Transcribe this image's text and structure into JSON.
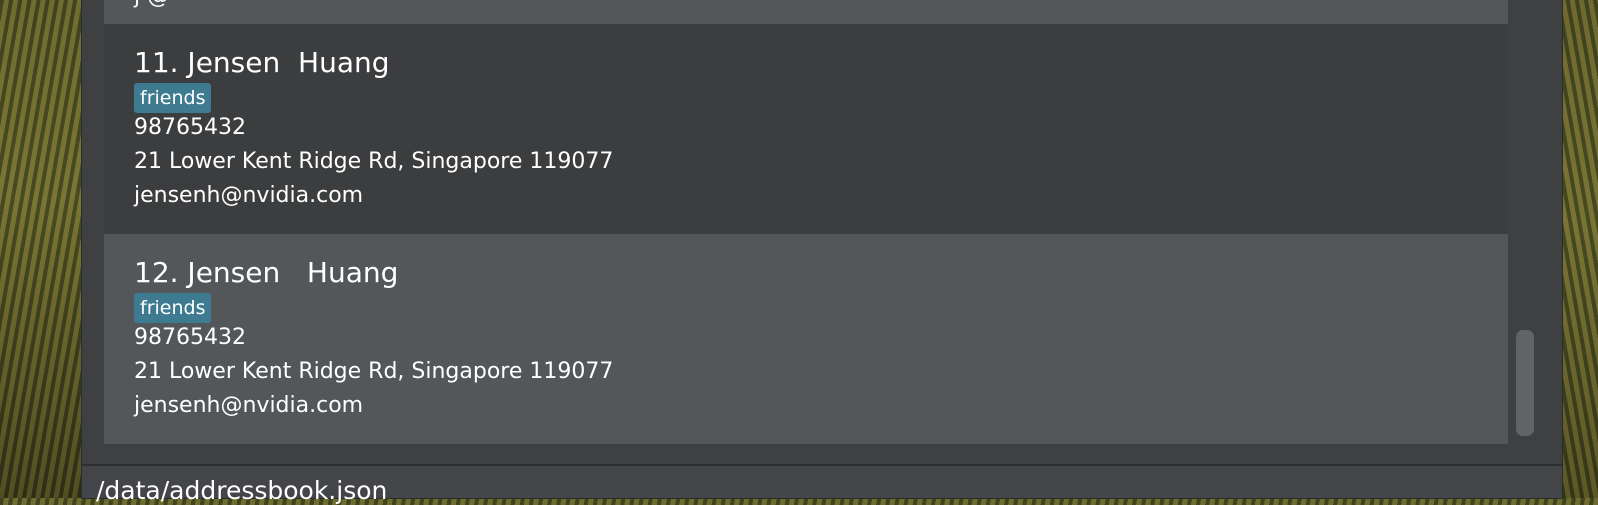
{
  "persons": [
    {
      "index": "11.",
      "name": "11. Jensen  Huang",
      "tags": [
        "friends"
      ],
      "phone": "98765432",
      "address": "21 Lower Kent Ridge Rd, Singapore 119077",
      "email": "jensenh@nvidia.com"
    },
    {
      "index": "12.",
      "name": "12. Jensen   Huang",
      "tags": [
        "friends"
      ],
      "phone": "98765432",
      "address": "21 Lower Kent Ridge Rd, Singapore 119077",
      "email": "jensenh@nvidia.com"
    }
  ],
  "status_bar": {
    "save_location": "/data/addressbook.json"
  }
}
